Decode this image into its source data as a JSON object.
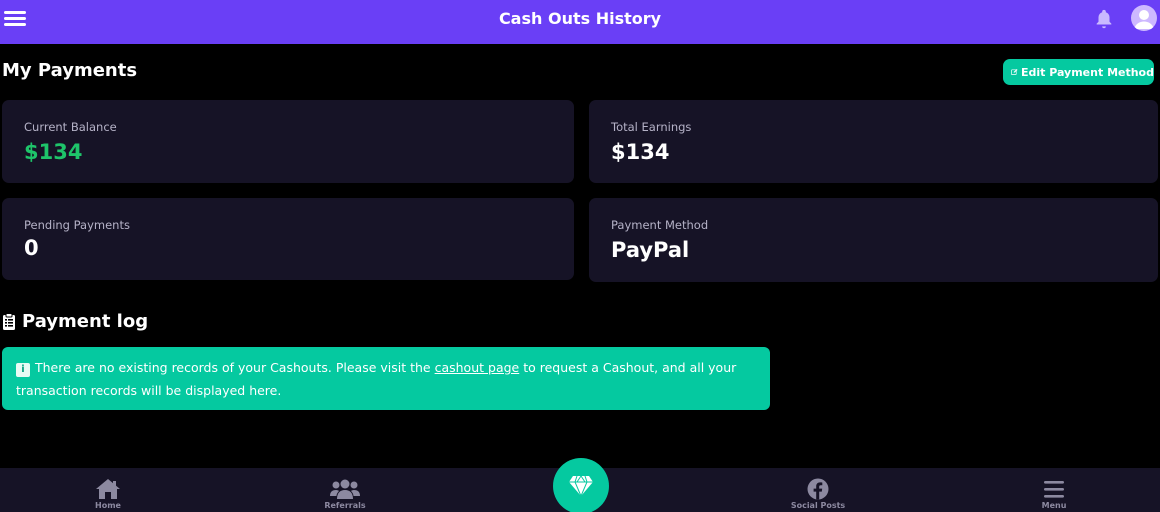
{
  "header": {
    "title": "Cash Outs History"
  },
  "payments": {
    "title": "My Payments",
    "edit_button": "Edit Payment Method",
    "cards": {
      "current_balance": {
        "label": "Current Balance",
        "value": "$134"
      },
      "total_earnings": {
        "label": "Total Earnings",
        "value": "$134"
      },
      "pending_payments": {
        "label": "Pending Payments",
        "value": "0"
      },
      "payment_method": {
        "label": "Payment Method",
        "value": "PayPal"
      }
    }
  },
  "log": {
    "title": "Payment log",
    "message_before": "There are no existing records of your Cashouts. Please visit the ",
    "link_text": "cashout page",
    "message_after": " to request a Cashout, and all your transaction records will be displayed here."
  },
  "bottom_nav": {
    "home": "Home",
    "referrals": "Referrals",
    "social_posts": "Social Posts",
    "menu": "Menu"
  },
  "colors": {
    "header_bg": "#6a3ff6",
    "accent": "#05c9a0",
    "balance_green": "#1ec46a",
    "card_bg": "#161326"
  },
  "icons": {
    "top_menu": "hamburger-icon",
    "notifications": "bell-icon",
    "profile": "user-avatar-icon",
    "edit": "edit-icon",
    "log": "clipboard-icon",
    "alert": "info-icon",
    "home": "home-icon",
    "referrals": "users-icon",
    "center": "diamond-icon",
    "social": "facebook-icon",
    "menu": "menu-icon"
  }
}
